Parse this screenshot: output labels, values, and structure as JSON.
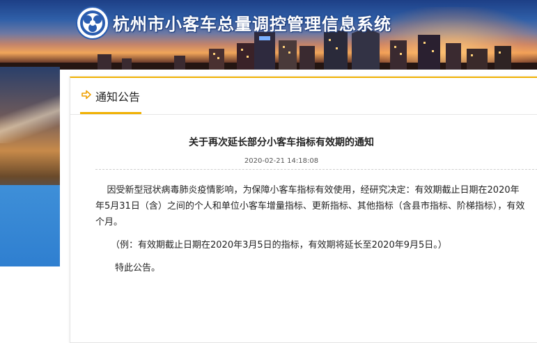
{
  "header": {
    "site_title": "杭州市小客车总量调控管理信息系统",
    "logo_icon": "hangzhou-emblem-icon"
  },
  "panel": {
    "section_title": "通知公告",
    "section_icon": "arrow-right-icon",
    "accent_color": "#f0b000"
  },
  "notice": {
    "title": "关于再次延长部分小客车指标有效期的通知",
    "date": "2020-02-21 14:18:08",
    "lines": [
      "    因受新型冠状病毒肺炎疫情影响，为保障小客车指标有效使用，经研究决定：有效期截止日期在2020年",
      "年5月31日（含）之间的个人和单位小客车增量指标、更新指标、其他指标（含县市指标、阶梯指标），有效",
      "个月。"
    ],
    "example": "（例：有效期截止日期在2020年3月5日的指标，有效期将延长至2020年9月5日。）",
    "closing": "特此公告。"
  }
}
